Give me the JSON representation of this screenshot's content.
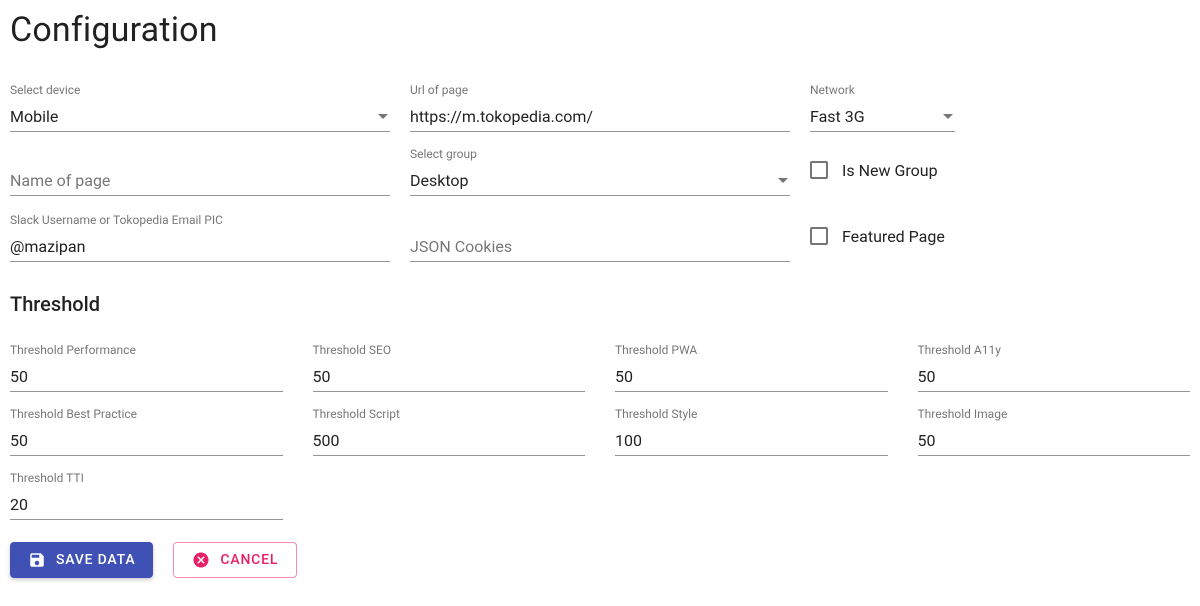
{
  "page": {
    "title": "Configuration",
    "threshold_heading": "Threshold"
  },
  "fields": {
    "device": {
      "label": "Select device",
      "value": "Mobile"
    },
    "url": {
      "label": "Url of page",
      "value": "https://m.tokopedia.com/"
    },
    "network": {
      "label": "Network",
      "value": "Fast 3G"
    },
    "name": {
      "placeholder": "Name of page"
    },
    "group": {
      "label": "Select group",
      "value": "Desktop"
    },
    "slack": {
      "label": "Slack Username or Tokopedia Email PIC",
      "value": "@mazipan"
    },
    "cookies": {
      "placeholder": "JSON Cookies"
    }
  },
  "checkboxes": {
    "new_group": {
      "label": "Is New Group",
      "checked": false
    },
    "featured": {
      "label": "Featured Page",
      "checked": false
    }
  },
  "thresholds": {
    "performance": {
      "label": "Threshold Performance",
      "value": "50"
    },
    "seo": {
      "label": "Threshold SEO",
      "value": "50"
    },
    "pwa": {
      "label": "Threshold PWA",
      "value": "50"
    },
    "a11y": {
      "label": "Threshold A11y",
      "value": "50"
    },
    "best_practice": {
      "label": "Threshold Best Practice",
      "value": "50"
    },
    "script": {
      "label": "Threshold Script",
      "value": "500"
    },
    "style": {
      "label": "Threshold Style",
      "value": "100"
    },
    "image": {
      "label": "Threshold Image",
      "value": "50"
    },
    "tti": {
      "label": "Threshold TTI",
      "value": "20"
    }
  },
  "actions": {
    "save": {
      "label": "Save Data"
    },
    "cancel": {
      "label": "Cancel"
    }
  }
}
